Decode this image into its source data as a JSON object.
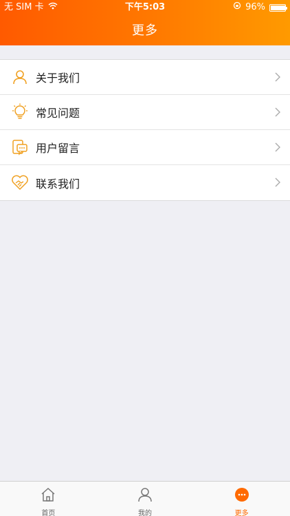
{
  "status_bar": {
    "carrier": "无 SIM 卡",
    "time": "下午5:03",
    "battery": "96%",
    "battery_level": 0.96
  },
  "header": {
    "title": "更多"
  },
  "menu": {
    "items": [
      {
        "label": "关于我们",
        "icon": "user-outline-icon"
      },
      {
        "label": "常见问题",
        "icon": "lightbulb-icon"
      },
      {
        "label": "用户留言",
        "icon": "message-icon"
      },
      {
        "label": "联系我们",
        "icon": "handshake-heart-icon"
      }
    ]
  },
  "tabbar": {
    "tabs": [
      {
        "label": "首页",
        "icon": "home-icon",
        "active": false
      },
      {
        "label": "我的",
        "icon": "user-icon",
        "active": false
      },
      {
        "label": "更多",
        "icon": "more-icon",
        "active": true
      }
    ]
  },
  "colors": {
    "accent": "#ff6a00",
    "icon": "#f0a020"
  }
}
